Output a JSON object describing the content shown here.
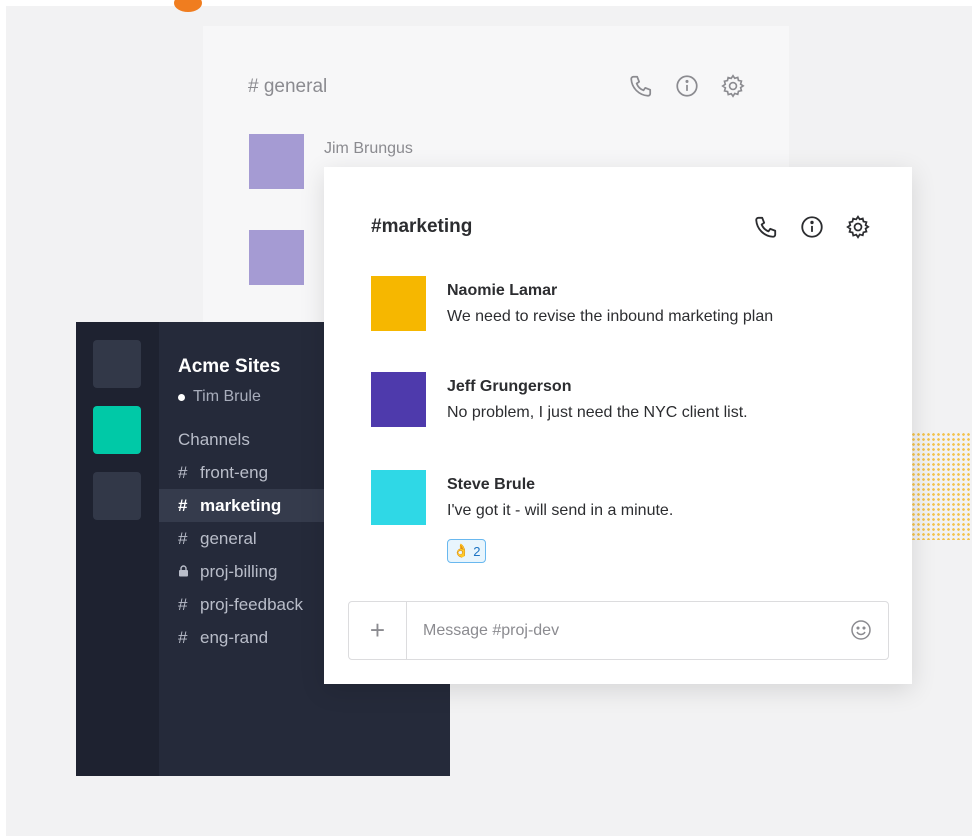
{
  "colors": {
    "sidebar_bg": "#252a3a",
    "rail_bg": "#1e2230",
    "active_workspace": "#00c9a7",
    "reaction_accent": "#1d74c3"
  },
  "back_channel": {
    "title": "# general",
    "message": {
      "sender": "Jim Brungus",
      "avatar_color": "#a59bd3"
    },
    "icons": [
      "phone-icon",
      "info-icon",
      "gear-icon"
    ]
  },
  "sidebar": {
    "workspace_name": "Acme Sites",
    "user": "Tim Brule",
    "channels_heading": "Channels",
    "channels": [
      {
        "symbol": "#",
        "name": "front-eng"
      },
      {
        "symbol": "#",
        "name": "marketing",
        "selected": true
      },
      {
        "symbol": "#",
        "name": "general"
      },
      {
        "symbol": "lock",
        "name": "proj-billing"
      },
      {
        "symbol": "#",
        "name": "proj-feedback"
      },
      {
        "symbol": "#",
        "name": "eng-rand"
      }
    ]
  },
  "front_channel": {
    "title": "#marketing",
    "icons": [
      "phone-icon",
      "info-icon",
      "gear-icon"
    ],
    "messages": [
      {
        "sender": "Naomie Lamar",
        "text": "We need to revise the inbound marketing plan",
        "avatar_color": "#f6b700"
      },
      {
        "sender": "Jeff Grungerson",
        "text": "No problem, I just need the NYC client list.",
        "avatar_color": "#4e3aac"
      },
      {
        "sender": "Steve Brule",
        "text": "I've got it - will send in a minute.",
        "avatar_color": "#2fd8e6"
      }
    ],
    "reaction": {
      "emoji": "👌",
      "count": "2"
    },
    "composer": {
      "plus": "+",
      "placeholder": "Message #proj-dev"
    }
  }
}
